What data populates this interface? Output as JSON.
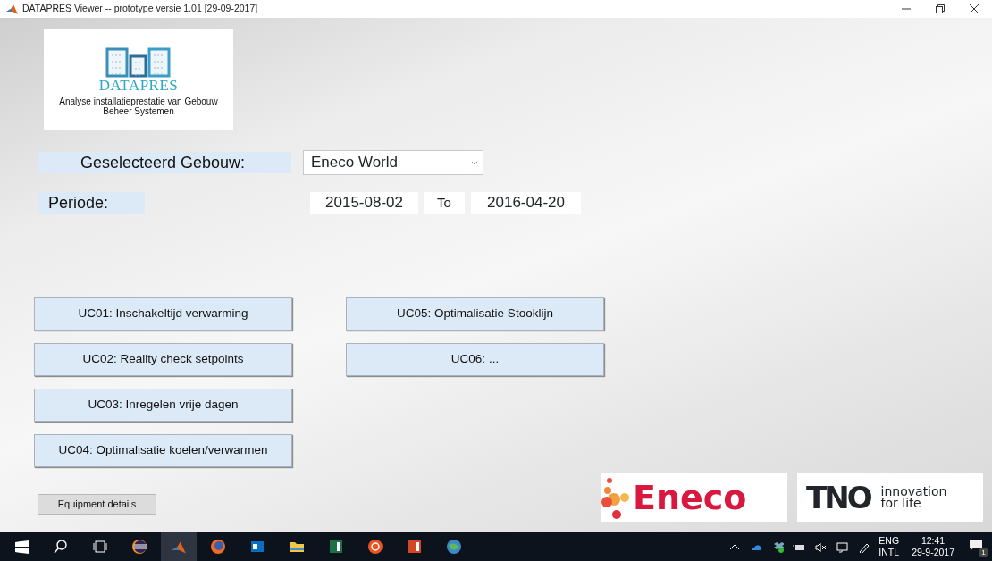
{
  "window": {
    "title": "DATAPRES Viewer -- prototype versie 1.01 [29-09-2017]"
  },
  "logo": {
    "name": "DATAPRES",
    "subtitle": "Analyse installatieprestatie van Gebouw Beheer Systemen"
  },
  "building": {
    "label": "Geselecteerd Gebouw:",
    "value": "Eneco World"
  },
  "period": {
    "label": "Periode:",
    "start": "2015-08-02",
    "separator": "To",
    "end": "2016-04-20"
  },
  "use_cases": [
    [
      {
        "label": "UC01: Inschakeltijd verwarming"
      },
      {
        "label": "UC02: Reality check setpoints"
      },
      {
        "label": "UC03: Inregelen vrije dagen"
      },
      {
        "label": "UC04: Optimalisatie koelen/verwarmen"
      }
    ],
    [
      {
        "label": "UC05: Optimalisatie Stooklijn"
      },
      {
        "label": "UC06: ..."
      }
    ]
  ],
  "equipment_button": "Equipment details",
  "partners": {
    "eneco": "Eneco",
    "tno": "TNO",
    "tno_tagline": "innovation for life"
  },
  "taskbar": {
    "apps": [
      {
        "kind": "windows",
        "active": false
      },
      {
        "kind": "search",
        "active": false
      },
      {
        "kind": "taskview",
        "active": false
      },
      {
        "kind": "eclipse",
        "active": false
      },
      {
        "kind": "matlab",
        "active": true
      },
      {
        "kind": "firefox",
        "active": false
      },
      {
        "kind": "outlook",
        "active": false
      },
      {
        "kind": "explorer",
        "active": false
      },
      {
        "kind": "excel",
        "active": false
      },
      {
        "kind": "ubuntu",
        "active": false
      },
      {
        "kind": "powerpoint",
        "active": false
      },
      {
        "kind": "network",
        "active": false
      }
    ],
    "language": "ENG",
    "layout": "INTL",
    "time": "12:41",
    "date": "29-9-2017",
    "notifications": "1"
  }
}
